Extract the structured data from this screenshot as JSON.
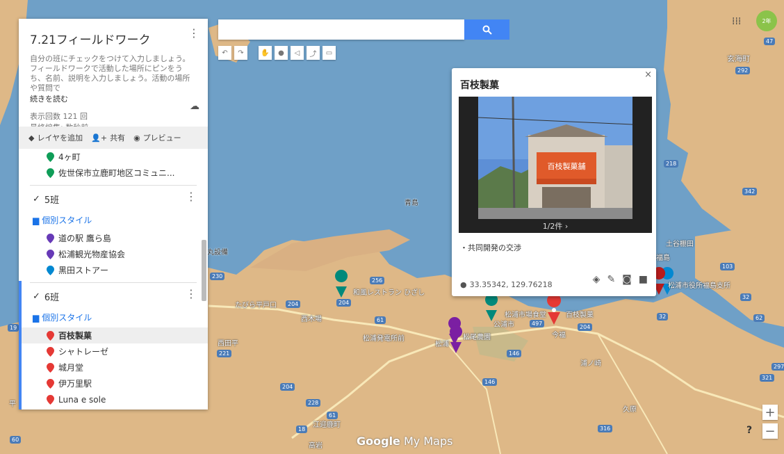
{
  "map_name": "7.21フィールドワーク",
  "description": "自分の班にチェックをつけて入力しましょう。フィールドワークで活動した場所にピンをうち、名前、説明を入力しましょう。活動の場所や質問で",
  "read_more": "続きを読む",
  "views": "表示回数 121 回",
  "last_edit": "最終編集: 数秒前",
  "toolbar": {
    "add_layer": "レイヤを追加",
    "share": "共有",
    "preview": "プレビュー"
  },
  "prev_items": [
    {
      "label": "4ヶ町",
      "color": "#0f9d58"
    },
    {
      "label": "佐世保市立鹿町地区コミュニ...",
      "color": "#0f9d58"
    }
  ],
  "layer5": {
    "name": "5班",
    "style": "個別スタイル",
    "items": [
      {
        "label": "道の駅 鷹ら島",
        "color": "#673ab7"
      },
      {
        "label": "松浦観光物産協会",
        "color": "#673ab7"
      },
      {
        "label": "黒田ストアー",
        "color": "#0288d1"
      }
    ]
  },
  "layer6": {
    "name": "6班",
    "style": "個別スタイル",
    "items": [
      {
        "label": "百枝製菓",
        "color": "#e53935"
      },
      {
        "label": "シャトレーゼ",
        "color": "#e53935"
      },
      {
        "label": "城月堂",
        "color": "#e53935"
      },
      {
        "label": "伊万里駅",
        "color": "#e53935"
      },
      {
        "label": "Luna e sole",
        "color": "#e53935"
      }
    ]
  },
  "popup": {
    "title": "百枝製菓",
    "photo_count": "1/2件 ›",
    "description": "・共同開発の交渉",
    "coords": "33.35342, 129.76218",
    "sign_text": "百枝製菓舗"
  },
  "map_labels": [
    {
      "text": "青島",
      "dark": true
    },
    {
      "text": "玄海町"
    },
    {
      "text": "土谷棚田"
    },
    {
      "text": "福島"
    },
    {
      "text": "松浦市役所福島支所"
    },
    {
      "text": "和風レストラン ひざし"
    },
    {
      "text": "たびら平戸口"
    },
    {
      "text": "西木場"
    },
    {
      "text": "松浦発電所前"
    },
    {
      "text": "松浦"
    },
    {
      "text": "松尾農園"
    },
    {
      "text": "松浦市場食堂"
    },
    {
      "text": "公浦市"
    },
    {
      "text": "百枝製菓"
    },
    {
      "text": "今福"
    },
    {
      "text": "浦ノ崎"
    },
    {
      "text": "西田平"
    },
    {
      "text": "江迎鹿町"
    },
    {
      "text": "高岩"
    },
    {
      "text": "久原"
    },
    {
      "text": "丸設備"
    },
    {
      "text": "平"
    }
  ],
  "route_shields": [
    "47",
    "292",
    "218",
    "342",
    "103",
    "32",
    "62",
    "19",
    "230",
    "204",
    "256",
    "61",
    "497",
    "204",
    "221",
    "146",
    "146",
    "204",
    "228",
    "61",
    "18",
    "316",
    "321",
    "297",
    "60",
    "32",
    "204"
  ],
  "watermark": {
    "google": "Google",
    "my_maps": "My Maps"
  },
  "zoom": {
    "in": "+",
    "out": "−"
  },
  "help": "?",
  "avatar_text": "2年"
}
